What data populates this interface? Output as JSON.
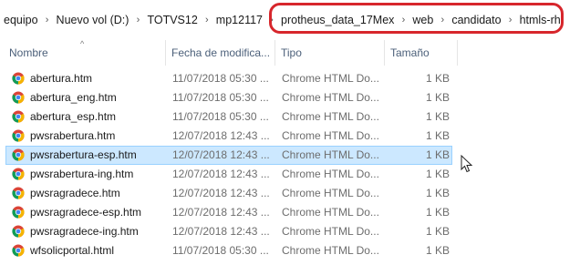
{
  "breadcrumb": {
    "items": [
      "equipo",
      "Nuevo vol (D:)",
      "TOTVS12",
      "mp12117",
      "protheus_data_17Mex",
      "web",
      "candidato",
      "htmls-rh"
    ],
    "separator": "›"
  },
  "columns": {
    "name": "Nombre",
    "date": "Fecha de modifica...",
    "type": "Tipo",
    "size": "Tamaño"
  },
  "files": [
    {
      "name": "abertura.htm",
      "date": "11/07/2018 05:30 ...",
      "type": "Chrome HTML Do...",
      "size": "1 KB",
      "icon": "chrome-icon"
    },
    {
      "name": "abertura_eng.htm",
      "date": "11/07/2018 05:30 ...",
      "type": "Chrome HTML Do...",
      "size": "1 KB",
      "icon": "chrome-icon"
    },
    {
      "name": "abertura_esp.htm",
      "date": "11/07/2018 05:30 ...",
      "type": "Chrome HTML Do...",
      "size": "1 KB",
      "icon": "chrome-icon"
    },
    {
      "name": "pwsrabertura.htm",
      "date": "12/07/2018 12:43 ...",
      "type": "Chrome HTML Do...",
      "size": "1 KB",
      "icon": "chrome-icon"
    },
    {
      "name": "pwsrabertura-esp.htm",
      "date": "12/07/2018 12:43 ...",
      "type": "Chrome HTML Do...",
      "size": "1 KB",
      "icon": "chrome-icon",
      "selected": true
    },
    {
      "name": "pwsrabertura-ing.htm",
      "date": "12/07/2018 12:43 ...",
      "type": "Chrome HTML Do...",
      "size": "1 KB",
      "icon": "chrome-icon"
    },
    {
      "name": "pwsragradece.htm",
      "date": "12/07/2018 12:43 ...",
      "type": "Chrome HTML Do...",
      "size": "1 KB",
      "icon": "chrome-icon"
    },
    {
      "name": "pwsragradece-esp.htm",
      "date": "12/07/2018 12:43 ...",
      "type": "Chrome HTML Do...",
      "size": "1 KB",
      "icon": "chrome-icon"
    },
    {
      "name": "pwsragradece-ing.htm",
      "date": "12/07/2018 12:43 ...",
      "type": "Chrome HTML Do...",
      "size": "1 KB",
      "icon": "chrome-icon"
    },
    {
      "name": "wfsolicportal.html",
      "date": "11/07/2018 05:30 ...",
      "type": "Chrome HTML Do...",
      "size": "1 KB",
      "icon": "chrome-icon"
    }
  ],
  "colors": {
    "selection_bg": "#cce8ff",
    "selection_border": "#99d1ff",
    "highlight_ring": "#d7262c",
    "header_text": "#4c607a"
  }
}
